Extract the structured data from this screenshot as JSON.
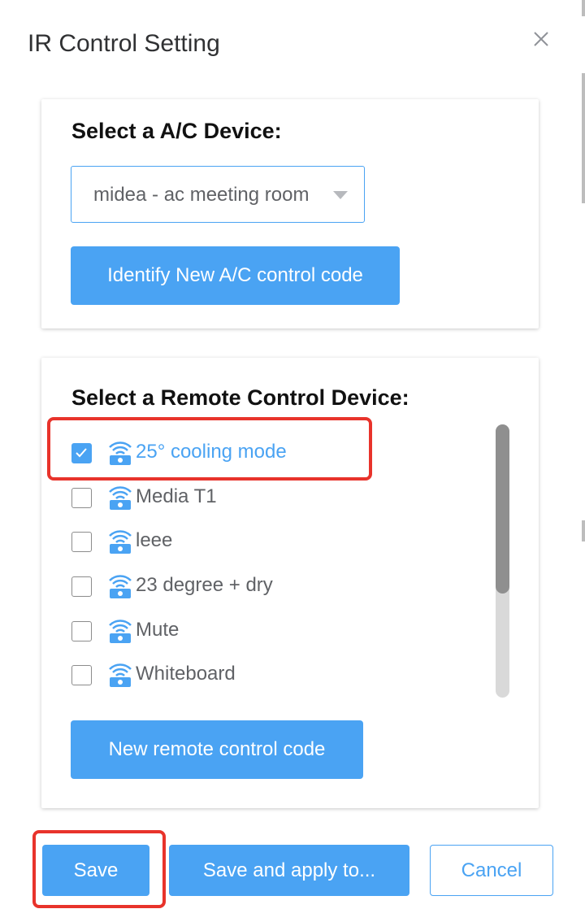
{
  "dialog": {
    "title": "IR Control Setting"
  },
  "ac_section": {
    "heading": "Select a A/C Device:",
    "selected_device": "midea - ac meeting room",
    "identify_button_label": "Identify New A/C control code"
  },
  "remote_section": {
    "heading": "Select a Remote Control Device:",
    "items": [
      {
        "label": "25° cooling mode",
        "checked": true
      },
      {
        "label": "Media T1",
        "checked": false
      },
      {
        "label": "leee",
        "checked": false
      },
      {
        "label": "23 degree + dry",
        "checked": false
      },
      {
        "label": "Mute",
        "checked": false
      },
      {
        "label": "Whiteboard",
        "checked": false
      }
    ],
    "new_button_label": "New remote control code"
  },
  "footer": {
    "save_label": "Save",
    "save_apply_label": "Save and apply to...",
    "cancel_label": "Cancel"
  },
  "colors": {
    "accent": "#4aa3f3",
    "highlight": "#e8332b",
    "text": "#606266",
    "heading": "#111111"
  },
  "icons": {
    "close": "close-icon",
    "remote": "remote-control-icon",
    "dropdown": "caret-down-icon",
    "check": "check-icon"
  }
}
